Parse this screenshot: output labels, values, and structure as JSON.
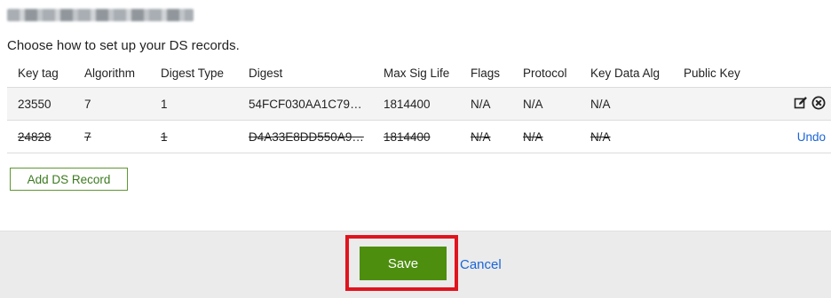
{
  "header": {
    "instruction": "Choose how to set up your DS records."
  },
  "table": {
    "columns": [
      "Key tag",
      "Algorithm",
      "Digest Type",
      "Digest",
      "Max Sig Life",
      "Flags",
      "Protocol",
      "Key Data Alg",
      "Public Key"
    ],
    "rows": [
      {
        "key_tag": "23550",
        "algorithm": "7",
        "digest_type": "1",
        "digest": "54FCF030AA1C79…",
        "max_sig_life": "1814400",
        "flags": "N/A",
        "protocol": "N/A",
        "key_data_alg": "N/A",
        "public_key": "",
        "actions": [
          "edit-icon",
          "remove-icon"
        ]
      },
      {
        "key_tag": "24828",
        "algorithm": "7",
        "digest_type": "1",
        "digest": "D4A33E8DD550A9…",
        "max_sig_life": "1814400",
        "flags": "N/A",
        "protocol": "N/A",
        "key_data_alg": "N/A",
        "public_key": "",
        "state": "deleted",
        "undo_label": "Undo"
      }
    ]
  },
  "buttons": {
    "add": "Add DS Record",
    "save": "Save",
    "cancel": "Cancel"
  },
  "colors": {
    "accent_green": "#4d8e0f",
    "link_blue": "#1a64d8",
    "highlight_red": "#e0141e"
  }
}
